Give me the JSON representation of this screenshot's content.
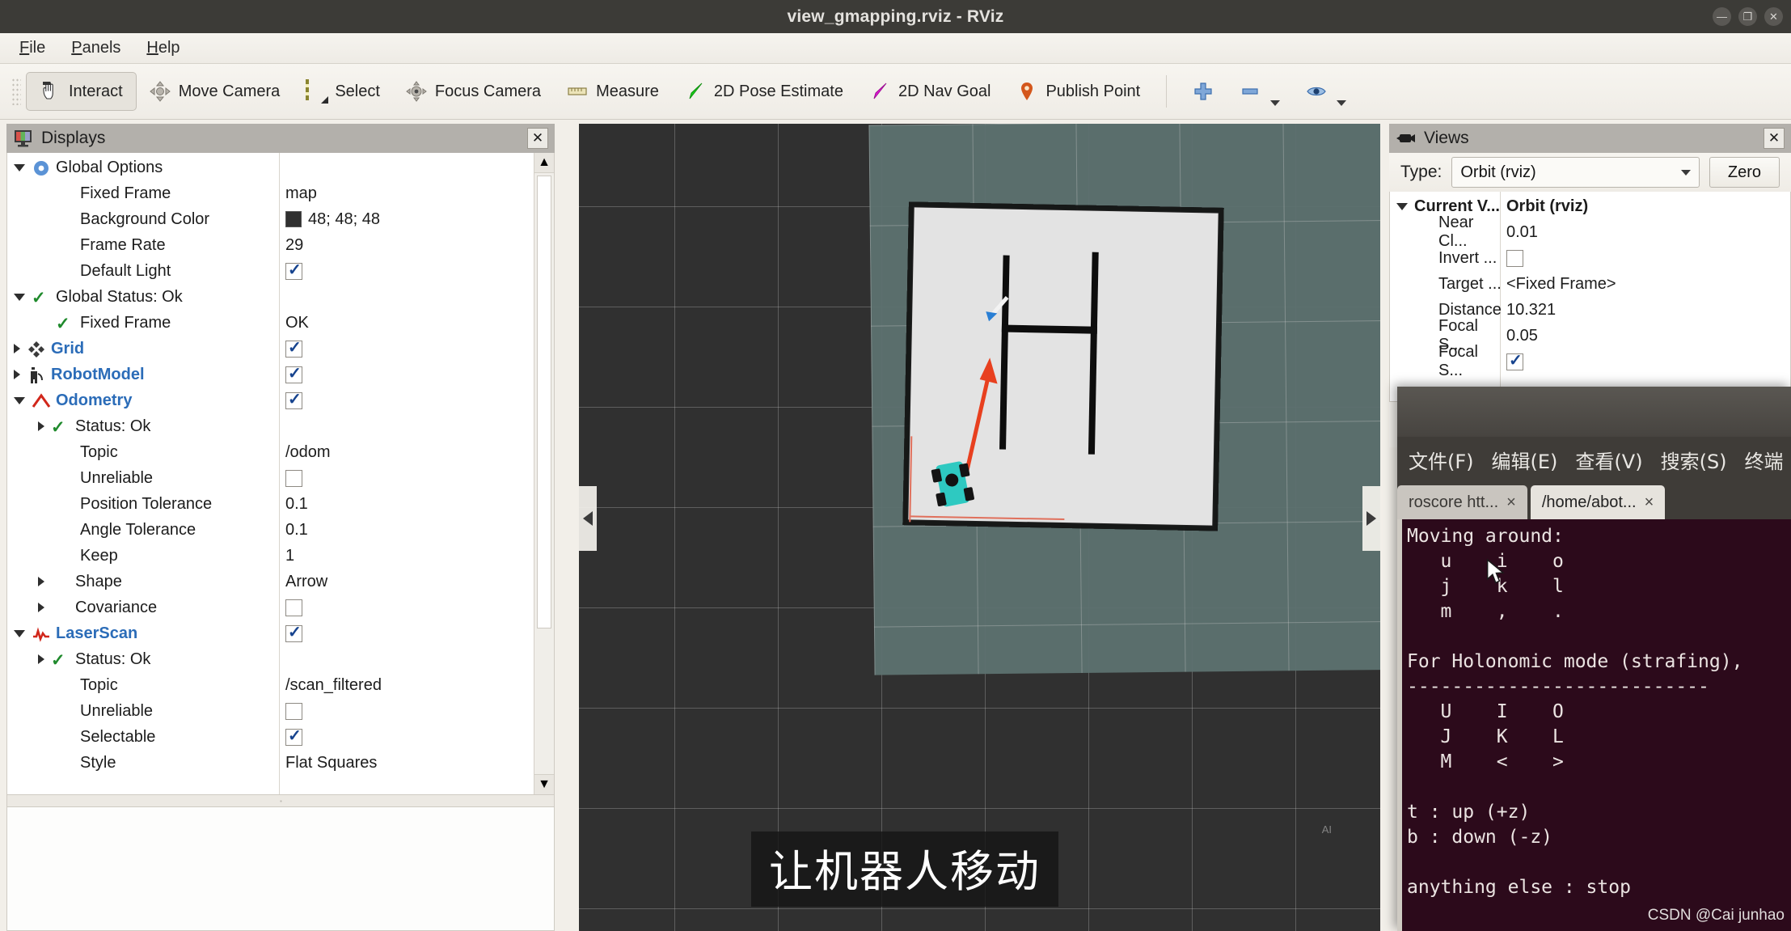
{
  "window": {
    "title": "view_gmapping.rviz - RViz",
    "buttons": [
      "minimize",
      "maximize",
      "close"
    ],
    "minimize_glyph": "—",
    "maximize_glyph": "❐",
    "close_glyph": "✕"
  },
  "menubar": {
    "items": [
      {
        "name": "file",
        "pre": "F",
        "post": "ile"
      },
      {
        "name": "panels",
        "pre": "P",
        "post": "anels"
      },
      {
        "name": "help",
        "pre": "H",
        "post": "elp"
      }
    ]
  },
  "toolbar": {
    "buttons": [
      {
        "label": "Interact",
        "icon": "hand-icon",
        "active": true
      },
      {
        "label": "Move Camera",
        "icon": "move-camera-icon",
        "active": false
      },
      {
        "label": "Select",
        "icon": "select-icon",
        "active": false
      },
      {
        "label": "Focus Camera",
        "icon": "focus-camera-icon",
        "active": false
      },
      {
        "label": "Measure",
        "icon": "ruler-icon",
        "active": false
      },
      {
        "label": "2D Pose Estimate",
        "icon": "green-arrow-icon",
        "active": false
      },
      {
        "label": "2D Nav Goal",
        "icon": "magenta-arrow-icon",
        "active": false
      },
      {
        "label": "Publish Point",
        "icon": "map-pin-icon",
        "active": false
      }
    ],
    "extra": [
      {
        "name": "add-display",
        "icon": "plus-icon"
      },
      {
        "name": "remove-display",
        "icon": "minus-icon"
      },
      {
        "name": "visibility",
        "icon": "eye-icon"
      }
    ]
  },
  "displays_panel": {
    "title": "Displays",
    "close_glyph": "✕",
    "rows": [
      {
        "indent": 0,
        "twisty": "open",
        "icon": "gear-icon",
        "label": "Global Options",
        "style": "plain",
        "value_type": "none",
        "value": ""
      },
      {
        "indent": 1,
        "twisty": "none",
        "icon": "",
        "label": "Fixed Frame",
        "style": "plain",
        "value_type": "text",
        "value": "map"
      },
      {
        "indent": 1,
        "twisty": "none",
        "icon": "",
        "label": "Background Color",
        "style": "plain",
        "value_type": "color",
        "value": "48; 48; 48",
        "color": "#303030"
      },
      {
        "indent": 1,
        "twisty": "none",
        "icon": "",
        "label": "Frame Rate",
        "style": "plain",
        "value_type": "text",
        "value": "29"
      },
      {
        "indent": 1,
        "twisty": "none",
        "icon": "",
        "label": "Default Light",
        "style": "plain",
        "value_type": "check",
        "value": "checked"
      },
      {
        "indent": 0,
        "twisty": "open",
        "icon": "check-icon",
        "label": "Global Status: Ok",
        "style": "plain",
        "value_type": "none",
        "value": ""
      },
      {
        "indent": 1,
        "twisty": "none",
        "icon": "check-icon",
        "label": "Fixed Frame",
        "style": "plain",
        "value_type": "text",
        "value": "OK"
      },
      {
        "indent": 0,
        "twisty": "closed",
        "icon": "grid-icon",
        "label": "Grid",
        "style": "blue",
        "value_type": "check",
        "value": "checked"
      },
      {
        "indent": 0,
        "twisty": "closed",
        "icon": "robot-icon",
        "label": "RobotModel",
        "style": "blue",
        "value_type": "check",
        "value": "checked"
      },
      {
        "indent": 0,
        "twisty": "open",
        "icon": "odometry-icon",
        "label": "Odometry",
        "style": "blue",
        "value_type": "check",
        "value": "checked"
      },
      {
        "indent": 1,
        "twisty": "closed",
        "icon": "check-icon",
        "label": "Status: Ok",
        "style": "plain",
        "value_type": "none",
        "value": ""
      },
      {
        "indent": 1,
        "twisty": "none",
        "icon": "",
        "label": "Topic",
        "style": "plain",
        "value_type": "text",
        "value": "/odom"
      },
      {
        "indent": 1,
        "twisty": "none",
        "icon": "",
        "label": "Unreliable",
        "style": "plain",
        "value_type": "check",
        "value": "unchecked"
      },
      {
        "indent": 1,
        "twisty": "none",
        "icon": "",
        "label": "Position Tolerance",
        "style": "plain",
        "value_type": "text",
        "value": "0.1"
      },
      {
        "indent": 1,
        "twisty": "none",
        "icon": "",
        "label": "Angle Tolerance",
        "style": "plain",
        "value_type": "text",
        "value": "0.1"
      },
      {
        "indent": 1,
        "twisty": "none",
        "icon": "",
        "label": "Keep",
        "style": "plain",
        "value_type": "text",
        "value": "1"
      },
      {
        "indent": 1,
        "twisty": "closed",
        "icon": "",
        "label": "Shape",
        "style": "plain",
        "value_type": "text",
        "value": "Arrow"
      },
      {
        "indent": 1,
        "twisty": "closed",
        "icon": "",
        "label": "Covariance",
        "style": "plain",
        "value_type": "check",
        "value": "unchecked"
      },
      {
        "indent": 0,
        "twisty": "open",
        "icon": "laserscan-icon",
        "label": "LaserScan",
        "style": "blue",
        "value_type": "check",
        "value": "checked"
      },
      {
        "indent": 1,
        "twisty": "closed",
        "icon": "check-icon",
        "label": "Status: Ok",
        "style": "plain",
        "value_type": "none",
        "value": ""
      },
      {
        "indent": 1,
        "twisty": "none",
        "icon": "",
        "label": "Topic",
        "style": "plain",
        "value_type": "text",
        "value": "/scan_filtered"
      },
      {
        "indent": 1,
        "twisty": "none",
        "icon": "",
        "label": "Unreliable",
        "style": "plain",
        "value_type": "check",
        "value": "unchecked"
      },
      {
        "indent": 1,
        "twisty": "none",
        "icon": "",
        "label": "Selectable",
        "style": "plain",
        "value_type": "check",
        "value": "checked"
      },
      {
        "indent": 1,
        "twisty": "none",
        "icon": "",
        "label": "Style",
        "style": "plain",
        "value_type": "text",
        "value": "Flat Squares"
      }
    ]
  },
  "views_panel": {
    "title": "Views",
    "close_glyph": "✕",
    "type_label": "Type:",
    "type_value": "Orbit (rviz)",
    "zero_label": "Zero",
    "rows": [
      {
        "indent": 0,
        "twisty": "open",
        "label": "Current V...",
        "bold": true,
        "value_type": "text",
        "value": "Orbit (rviz)"
      },
      {
        "indent": 1,
        "twisty": "none",
        "label": "Near Cl...",
        "bold": false,
        "value_type": "text",
        "value": "0.01"
      },
      {
        "indent": 1,
        "twisty": "none",
        "label": "Invert ...",
        "bold": false,
        "value_type": "check",
        "value": "unchecked"
      },
      {
        "indent": 1,
        "twisty": "none",
        "label": "Target ...",
        "bold": false,
        "value_type": "text",
        "value": "<Fixed Frame>"
      },
      {
        "indent": 1,
        "twisty": "none",
        "label": "Distance",
        "bold": false,
        "value_type": "text",
        "value": "10.321"
      },
      {
        "indent": 1,
        "twisty": "none",
        "label": "Focal S...",
        "bold": false,
        "value_type": "text",
        "value": "0.05"
      },
      {
        "indent": 1,
        "twisty": "none",
        "label": "Focal S...",
        "bold": false,
        "value_type": "check",
        "value": "checked"
      }
    ]
  },
  "viewport": {
    "subtitle": "让机器人移动",
    "ai_tag": "AI",
    "left_collapse_glyph": "◀",
    "right_collapse_glyph": "▶",
    "background_color": "#303030",
    "ground_color": "#5d7270",
    "map_color": "#e3e3e3",
    "wall_color": "#0d0d0d",
    "robot_color": "#2ec9c1",
    "odom_arrow_color": "#e8401f",
    "pose_arrow_color": "#2a7fd4"
  },
  "terminal": {
    "menu_items": [
      {
        "name": "file",
        "label": "文件(F)"
      },
      {
        "name": "edit",
        "label": "编辑(E)"
      },
      {
        "name": "view",
        "label": "查看(V)"
      },
      {
        "name": "search",
        "label": "搜索(S)"
      },
      {
        "name": "terminal",
        "label": "终端"
      }
    ],
    "tabs": [
      {
        "label": "roscore htt...",
        "close": "×",
        "active": false
      },
      {
        "label": "/home/abot...",
        "close": "×",
        "active": true
      }
    ],
    "output": "Moving around:\n   u    i    o\n   j    k    l\n   m    ,    .\n\nFor Holonomic mode (strafing),\n---------------------------\n   U    I    O\n   J    K    L\n   M    <    >\n\nt : up (+z)\nb : down (-z)\n\nanything else : stop",
    "watermark": "CSDN @Cai junhao"
  }
}
